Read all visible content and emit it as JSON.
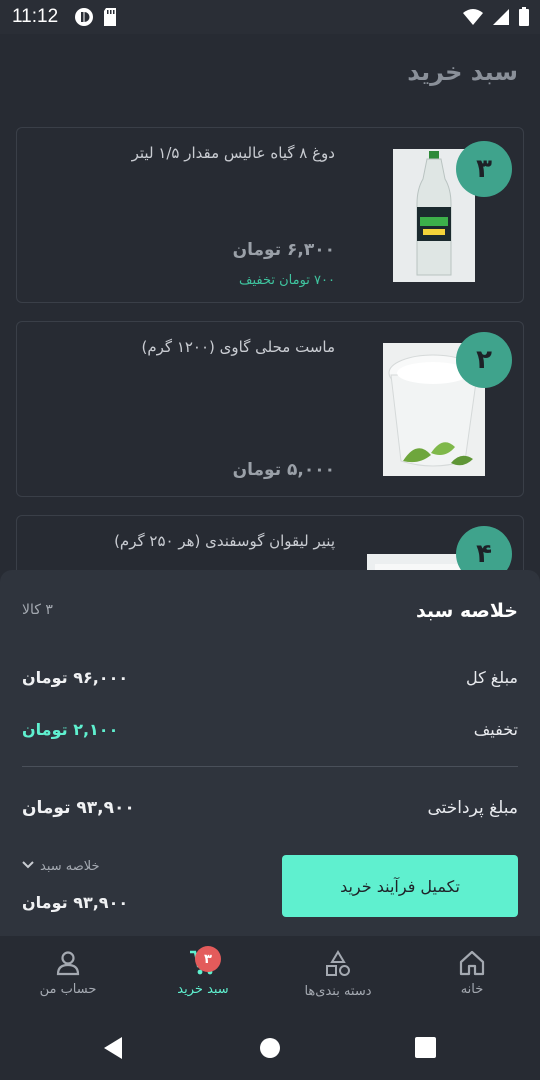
{
  "status_bar": {
    "time": "11:12"
  },
  "page": {
    "title": "سبد خرید"
  },
  "cart_items": [
    {
      "quantity": "۳",
      "name": "دوغ ۸ گیاه عالیس مقدار ۱/۵ لیتر",
      "price": "۶,۳۰۰ تومان",
      "discount": "۷۰۰ تومان تخفیف"
    },
    {
      "quantity": "۲",
      "name": "ماست محلی گاوی (۱۲۰۰ گرم)",
      "price": "۵,۰۰۰ تومان"
    },
    {
      "quantity": "۴",
      "name": "پنیر لیقوان گوسفندی (هر ۲۵۰ گرم)"
    }
  ],
  "summary": {
    "title": "خلاصه سبد",
    "item_count": "۳ کالا",
    "total_label": "مبلغ کل",
    "total_value": "۹۶,۰۰۰ تومان",
    "discount_label": "تخفیف",
    "discount_value": "۲,۱۰۰ تومان",
    "payable_label": "مبلغ پرداختی",
    "payable_value": "۹۳,۹۰۰ تومان",
    "toggle_label": "خلاصه سبد",
    "toggle_total": "۹۳,۹۰۰ تومان",
    "checkout_label": "تکمیل فرآیند خرید"
  },
  "bottom_nav": {
    "items": [
      {
        "label": "حساب من",
        "icon": "person-icon"
      },
      {
        "label": "سبد خرید",
        "icon": "cart-icon",
        "badge": "۳",
        "active": true
      },
      {
        "label": "دسته بندی‌ها",
        "icon": "categories-icon"
      },
      {
        "label": "خانه",
        "icon": "home-icon"
      }
    ]
  },
  "colors": {
    "accent": "#5ff0cf",
    "badge": "#3fa38c",
    "alert": "#e35b5b",
    "background": "#272b33"
  }
}
